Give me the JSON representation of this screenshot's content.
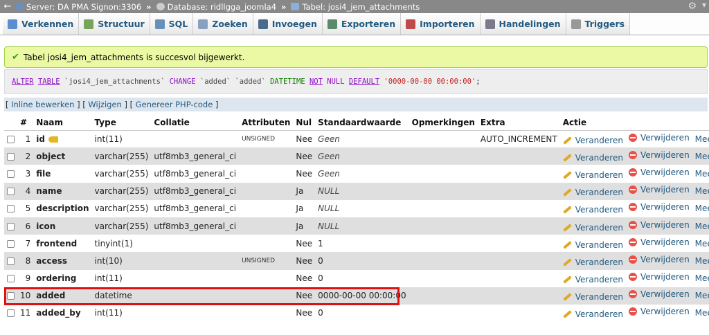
{
  "breadcrumb": {
    "server": "Server: DA PMA Signon:3306",
    "database": "Database: ridllgga_joomla4",
    "table": "Tabel: josi4_jem_attachments",
    "separator": "»"
  },
  "tabs": [
    {
      "label": "Verkennen",
      "icon": "browse-icon",
      "color": "#5b8ed0"
    },
    {
      "label": "Structuur",
      "icon": "structure-icon",
      "color": "#7aa35a"
    },
    {
      "label": "SQL",
      "icon": "sql-icon",
      "color": "#6a8fb8"
    },
    {
      "label": "Zoeken",
      "icon": "search-icon",
      "color": "#8aa0c0"
    },
    {
      "label": "Invoegen",
      "icon": "insert-icon",
      "color": "#4a6b8a"
    },
    {
      "label": "Exporteren",
      "icon": "export-icon",
      "color": "#5a8a6a"
    },
    {
      "label": "Importeren",
      "icon": "import-icon",
      "color": "#c04a4a"
    },
    {
      "label": "Handelingen",
      "icon": "wrench-icon",
      "color": "#7a7a8a"
    },
    {
      "label": "Triggers",
      "icon": "triggers-icon",
      "color": "#999999"
    }
  ],
  "success_message": "Tabel josi4_jem_attachments is succesvol bijgewerkt.",
  "sql": {
    "alter": "ALTER",
    "table": "TABLE",
    "tablename": "`josi4_jem_attachments`",
    "change": "CHANGE",
    "col1": "`added`",
    "col2": "`added`",
    "datatype": "DATETIME",
    "not": "NOT",
    "null": "NULL",
    "default": "DEFAULT",
    "value": "'0000-00-00 00:00:00'",
    "end": ";"
  },
  "sql_actions": {
    "inline": "Inline bewerken",
    "edit": "Wijzigen",
    "php": "Genereer PHP-code",
    "open": "[",
    "close": "]",
    "between": "] ["
  },
  "columns": [
    "#",
    "Naam",
    "Type",
    "Collatie",
    "Attributen",
    "Nul",
    "Standaardwaarde",
    "Opmerkingen",
    "Extra",
    "Actie"
  ],
  "actions": {
    "change": "Veranderen",
    "delete": "Verwijderen",
    "more": "Meer"
  },
  "rows": [
    {
      "num": "1",
      "name": "id",
      "type": "int(11)",
      "collation": "",
      "attributes": "UNSIGNED",
      "null": "Nee",
      "default": "Geen",
      "comments": "",
      "extra": "AUTO_INCREMENT",
      "primary": true
    },
    {
      "num": "2",
      "name": "object",
      "type": "varchar(255)",
      "collation": "utf8mb3_general_ci",
      "attributes": "",
      "null": "Nee",
      "default": "Geen",
      "comments": "",
      "extra": ""
    },
    {
      "num": "3",
      "name": "file",
      "type": "varchar(255)",
      "collation": "utf8mb3_general_ci",
      "attributes": "",
      "null": "Nee",
      "default": "Geen",
      "comments": "",
      "extra": ""
    },
    {
      "num": "4",
      "name": "name",
      "type": "varchar(255)",
      "collation": "utf8mb3_general_ci",
      "attributes": "",
      "null": "Ja",
      "default": "NULL",
      "comments": "",
      "extra": ""
    },
    {
      "num": "5",
      "name": "description",
      "type": "varchar(255)",
      "collation": "utf8mb3_general_ci",
      "attributes": "",
      "null": "Ja",
      "default": "NULL",
      "comments": "",
      "extra": ""
    },
    {
      "num": "6",
      "name": "icon",
      "type": "varchar(255)",
      "collation": "utf8mb3_general_ci",
      "attributes": "",
      "null": "Ja",
      "default": "NULL",
      "comments": "",
      "extra": ""
    },
    {
      "num": "7",
      "name": "frontend",
      "type": "tinyint(1)",
      "collation": "",
      "attributes": "",
      "null": "Nee",
      "default": "1",
      "comments": "",
      "extra": ""
    },
    {
      "num": "8",
      "name": "access",
      "type": "int(10)",
      "collation": "",
      "attributes": "UNSIGNED",
      "null": "Nee",
      "default": "0",
      "comments": "",
      "extra": ""
    },
    {
      "num": "9",
      "name": "ordering",
      "type": "int(11)",
      "collation": "",
      "attributes": "",
      "null": "Nee",
      "default": "0",
      "comments": "",
      "extra": ""
    },
    {
      "num": "10",
      "name": "added",
      "type": "datetime",
      "collation": "",
      "attributes": "",
      "null": "Nee",
      "default": "0000-00-00 00:00:00",
      "comments": "",
      "extra": ""
    },
    {
      "num": "11",
      "name": "added_by",
      "type": "int(11)",
      "collation": "",
      "attributes": "",
      "null": "Nee",
      "default": "0",
      "comments": "",
      "extra": ""
    }
  ],
  "colors": {
    "highlight": "#e01010",
    "success_bg": "#ebf8a4",
    "link": "#235a81"
  }
}
